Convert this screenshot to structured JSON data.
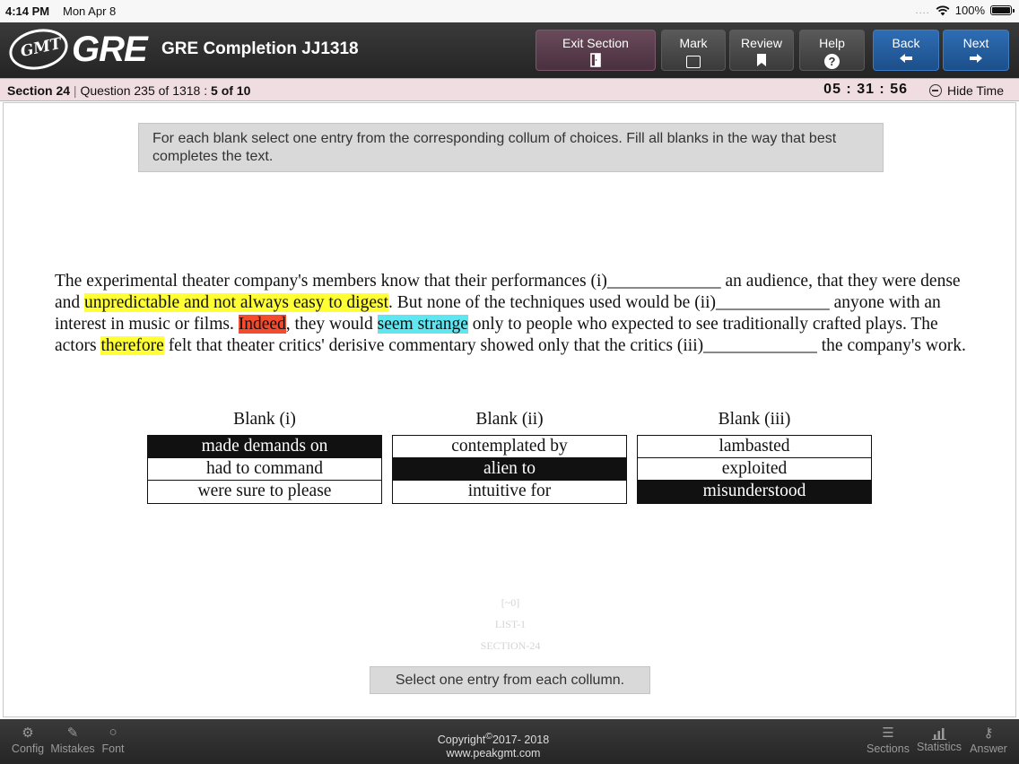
{
  "statusbar": {
    "time": "4:14 PM",
    "date": "Mon Apr 8",
    "dots": "....",
    "battery": "100%"
  },
  "header": {
    "logo_badge": "GMT",
    "logo_text": "GRE",
    "title": "GRE Completion JJ1318",
    "buttons": {
      "exit": "Exit Section",
      "mark": "Mark",
      "review": "Review",
      "help": "Help",
      "back": "Back",
      "next": "Next"
    }
  },
  "infobar": {
    "section": "Section 24",
    "divider": "|",
    "question": "Question 235 of 1318 :",
    "progress": "5 of 10",
    "timer": "05 : 31 : 56",
    "hide_time": "Hide Time"
  },
  "instruction": "For each blank select one entry from the corresponding collum of choices. Fill all blanks in the way that best completes the text.",
  "passage": {
    "p1": "The experimental theater company's members know that their performances (i)_____________ an audience, that they were dense and ",
    "hl1": "unpredictable and not always easy to digest",
    "p2": ". But none of the techniques used would be (ii)_____________ anyone with an interest in music or films. ",
    "hl2": "Indeed",
    "p3": ", they would ",
    "hl3": "seem strange",
    "p4": " only to people who expected to see traditionally crafted plays. The actors ",
    "hl4": "therefore",
    "p5": " felt that theater critics' derisive commentary showed only that the critics (iii)_____________ the company's work."
  },
  "blanks": [
    {
      "header": "Blank (i)",
      "options": [
        "made demands on",
        "had to command",
        "were sure to please"
      ],
      "selected": 0
    },
    {
      "header": "Blank (ii)",
      "options": [
        "contemplated by",
        "alien to",
        "intuitive for"
      ],
      "selected": 1
    },
    {
      "header": "Blank (iii)",
      "options": [
        "lambasted",
        "exploited",
        "misunderstood"
      ],
      "selected": 2
    }
  ],
  "faint_labels": [
    "[~0]",
    "LIST-1",
    "SECTION-24"
  ],
  "hint": "Select one entry from each collumn.",
  "footer": {
    "config": "Config",
    "mistakes": "Mistakes",
    "font": "Font",
    "copyright_line1": "Copyright",
    "copyright_symbol": "©",
    "copyright_years": "2017- 2018",
    "copyright_line2": "www.peakgmt.com",
    "sections": "Sections",
    "statistics": "Statistics",
    "answer": "Answer"
  },
  "colors": {
    "highlight_yellow": "#ffff33",
    "highlight_red": "#f44a2e",
    "highlight_cyan": "#5fe6f0",
    "nav_blue": "#2e6db4",
    "selected_bg": "#111111"
  }
}
